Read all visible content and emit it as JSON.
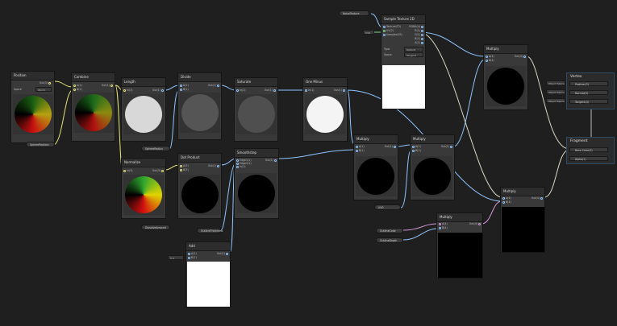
{
  "nodes": {
    "position": {
      "title": "Position",
      "out": "Out(3)",
      "space_label": "Space",
      "space_value": "World"
    },
    "combine": {
      "title": "Combine",
      "in_a": "A(1)",
      "in_b": "B(1)",
      "out": "Out(1)"
    },
    "length": {
      "title": "Length",
      "in": "In(3)",
      "out": "Out(1)"
    },
    "divide": {
      "title": "Divide",
      "in_a": "A(1)",
      "in_b": "B(1)",
      "out": "Out(1)"
    },
    "saturate": {
      "title": "Saturate",
      "in": "In(1)",
      "out": "Out(1)"
    },
    "one_minus": {
      "title": "One Minus",
      "in": "In(1)",
      "out": "Out(1)"
    },
    "normalize": {
      "title": "Normalize",
      "in": "In(3)",
      "out": "Out(3)"
    },
    "dot_product": {
      "title": "Dot Product",
      "in_a": "A(3)",
      "in_b": "B(3)",
      "out": "Out(1)"
    },
    "smoothstep": {
      "title": "Smoothstep",
      "edge1": "Edge1(1)",
      "edge2": "Edge2(1)",
      "in": "In(1)",
      "out": "Out(1)"
    },
    "add": {
      "title": "Add",
      "in_a": "A(1)",
      "in_b": "B(1)",
      "out": "Out(1)"
    },
    "multiply1": {
      "title": "Multiply",
      "in_a": "A(1)",
      "in_b": "B(1)",
      "out": "Out(1)"
    },
    "multiply2": {
      "title": "Multiply",
      "in_a": "A(1)",
      "in_b": "B(1)",
      "out": "Out(1)"
    },
    "multiply3": {
      "title": "Multiply",
      "in_a": "A(4)",
      "in_b": "B(4)",
      "out": "Out(4)"
    },
    "multiply4": {
      "title": "Multiply",
      "in_a": "A(4)",
      "in_b": "B(4)",
      "out": "Out(4)"
    },
    "multiply5": {
      "title": "Multiply",
      "in_a": "A(4)",
      "in_b": "B(4)",
      "out": "Out(4)"
    },
    "sample_texture": {
      "title": "Sample Texture 2D",
      "in_texture": "Texture(T2)",
      "in_uv": "UV(2)",
      "in_sampler": "Sampler(SS)",
      "outs": [
        "RGBA(4)",
        "R(1)",
        "G(1)",
        "B(1)",
        "A(1)"
      ],
      "type_label": "Type",
      "type_value": "Default",
      "space_label": "Space",
      "space_value": "Tangent"
    }
  },
  "properties": {
    "sphere_position": "SpherePosition",
    "sphere_radius": "SphereRadius",
    "dissolve_amount": "DissolveAmount",
    "outline_thickness": "OutlineThickness",
    "outline_depth": "OutlineDepth",
    "noise_texture": "NoiseTexture",
    "uv0": "UV0",
    "uv_channel": "UV0",
    "outline_color": "OutlineColor",
    "base_color": "BaseColor"
  },
  "inline": {
    "uv_tag": "UV0",
    "x_label": "X",
    "x_value": "0"
  },
  "master": {
    "vertex_title": "Vertex",
    "vertex_slots": [
      "Position(3)",
      "Normal(3)",
      "Tangent(3)"
    ],
    "object_space": "Object Space",
    "fragment_title": "Fragment",
    "fragment_slots": [
      "Base Color(3)",
      "Alpha(1)"
    ]
  },
  "colors": {
    "background": "#1f1f1f",
    "wire_default": "#8ec5ff",
    "wire_yellow": "#e8e37a",
    "wire_green": "#7fd68f",
    "wire_purple": "#d59ad9"
  }
}
